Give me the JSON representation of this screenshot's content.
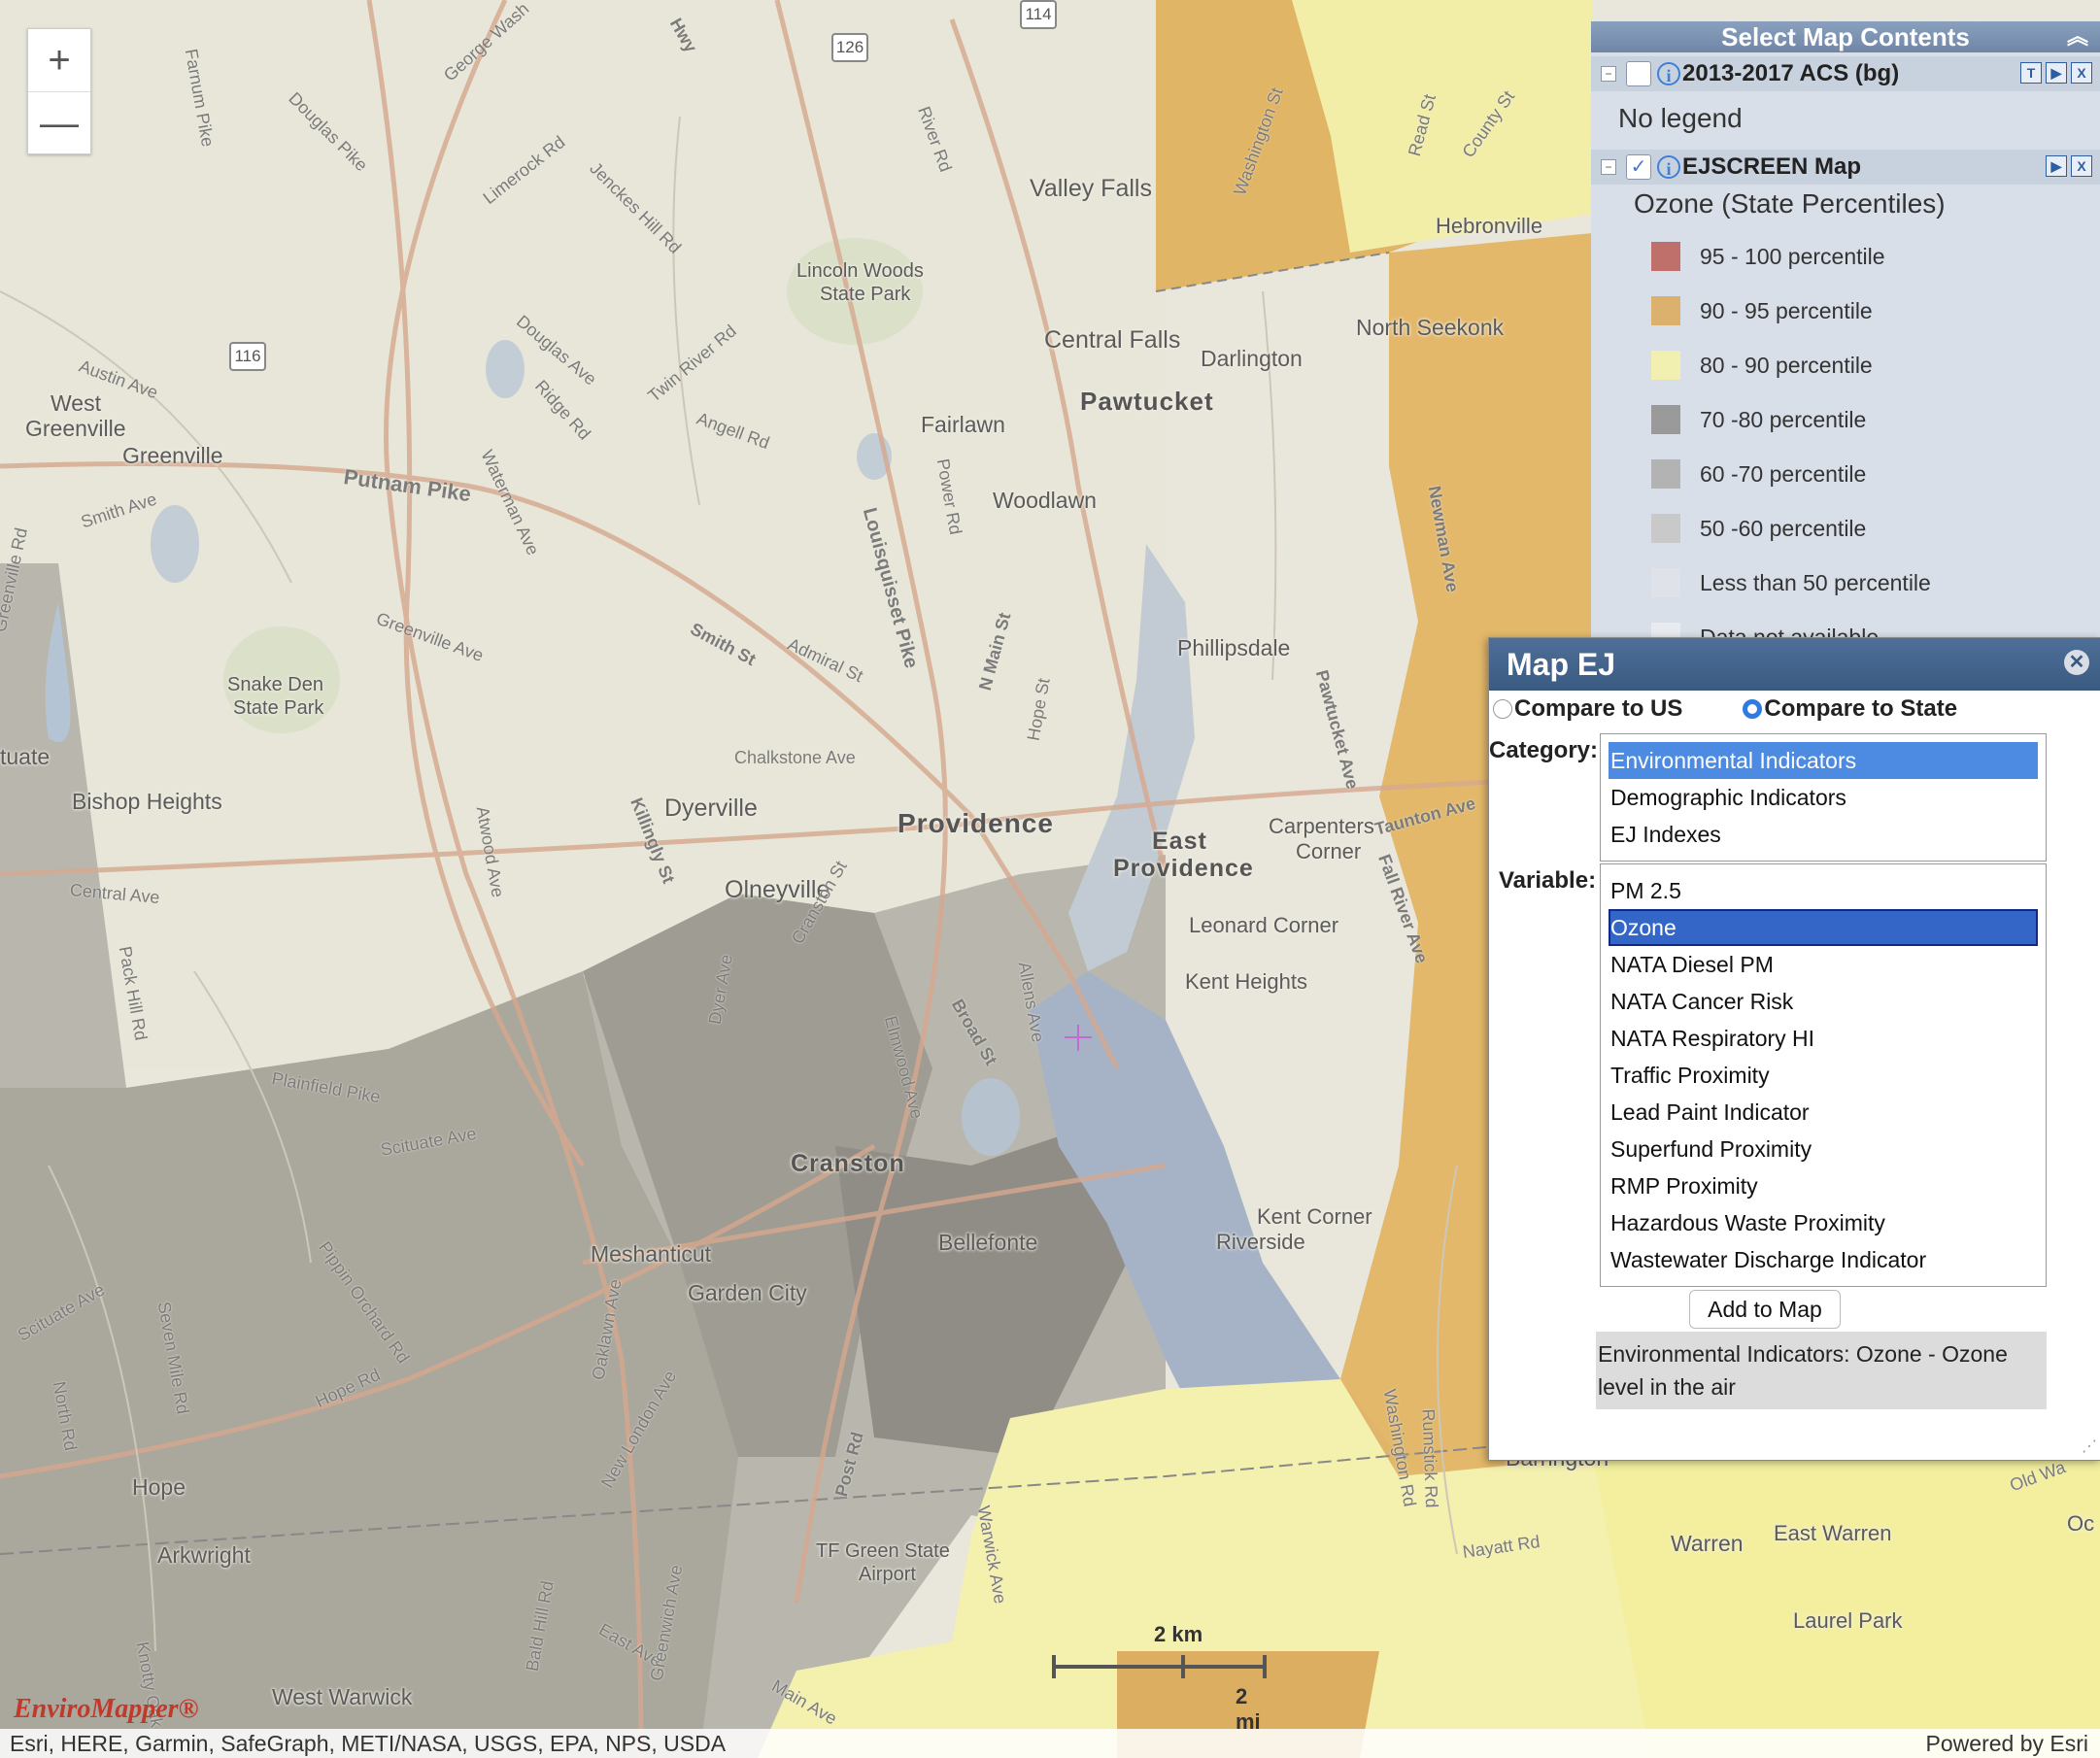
{
  "map": {
    "zoom_in": "+",
    "zoom_out": "—",
    "places": {
      "valley_falls": "Valley Falls",
      "lincoln_woods": "Lincoln Woods",
      "state_park": "State Park",
      "central_falls": "Central Falls",
      "darlington": "Darlington",
      "pawtucket": "Pawtucket",
      "fairlawn": "Fairlawn",
      "woodlawn": "Woodlawn",
      "hebronville": "Hebronville",
      "north_seekonk": "North Seekonk",
      "west_greenville": "West Greenville",
      "west": "West",
      "greenville_a": "Greenville",
      "greenville": "Greenville",
      "phillipsdale": "Phillipsdale",
      "snake_den": "Snake Den",
      "snake_den_sp": "State Park",
      "tuate": "tuate",
      "bishop_heights": "Bishop Heights",
      "dyerville": "Dyerville",
      "providence": "Providence",
      "east": "East",
      "providence2": "Providence",
      "carpenters": "Carpenters",
      "corner": "Corner",
      "olneyville": "Olneyville",
      "leonard_corner": "Leonard Corner",
      "kent_heights": "Kent Heights",
      "cranston": "Cranston",
      "kent_corner": "Kent Corner",
      "riverside": "Riverside",
      "meshanticut": "Meshanticut",
      "bellefonte": "Bellefonte",
      "garden_city": "Garden City",
      "hope": "Hope",
      "arkwright": "Arkwright",
      "warren": "Warren",
      "east_warren": "East Warren",
      "tf_green": "TF Green State",
      "airport": "Airport",
      "laurel_park": "Laurel Park",
      "west_warwick": "West Warwick",
      "barrington": "Barrington",
      "oc": "Oc"
    },
    "roads": {
      "farnum_pike": "Farnum Pike",
      "george_wash": "George Wash",
      "douglas_pike": "Douglas Pike",
      "limerock": "Limerock Rd",
      "jenckes": "Jenckes Hill Rd",
      "river_rd": "River Rd",
      "washington_st": "Washington St",
      "read_st": "Read St",
      "county_st": "County St",
      "twin_river": "Twin River Rd",
      "angell": "Angell Rd",
      "ridge": "Ridge Rd",
      "douglas_ave": "Douglas Ave",
      "austin_ave": "Austin Ave",
      "smith_ave": "Smith Ave",
      "putnam_pike": "Putnam Pike",
      "waterman": "Waterman Ave",
      "louisquisset": "Louisquisset Pike",
      "power_rd": "Power Rd",
      "smith_st": "Smith St",
      "admiral": "Admiral St",
      "n_main": "N Main St",
      "hope_st": "Hope St",
      "greenville_ave": "Greenville Ave",
      "chalkstone": "Chalkstone Ave",
      "atwood": "Atwood Ave",
      "killingly": "Killingly St",
      "newman": "Newman Ave",
      "pawtucket_ave": "Pawtucket Ave",
      "taunton": "Taunton Ave",
      "fall_river": "Fall River Ave",
      "central_ave": "Central Ave",
      "pippin": "Pippin Orchard Rd",
      "cranston_st": "Cranston St",
      "dyer": "Dyer Ave",
      "elmwood": "Elmwood Ave",
      "broad": "Broad St",
      "allens": "Allens Ave",
      "plainfield": "Plainfield Pike",
      "scituate": "Scituate Ave",
      "scituate2": "Scituate Ave",
      "seven_mile": "Seven Mile Rd",
      "hope_rd": "Hope Rd",
      "oaklawn": "Oaklawn Ave",
      "new_london": "New London Ave",
      "post_rd": "Post Rd",
      "warwick": "Warwick Ave",
      "nayatt": "Nayatt Rd",
      "north_rd": "North Rd",
      "pack_hill": "Pack Hill Rd",
      "east_ave": "East Ave",
      "bald_hill": "Bald Hill Rd",
      "greenwich": "Greenwich Ave",
      "main_ave": "Main Ave",
      "greenville_rd": "Greenville Rd",
      "old_wa": "Old Wa",
      "washington_rd": "Washington Rd",
      "rumstick": "Rumstick Rd",
      "knotty": "Knotty Oak",
      "hwy": "Hwy"
    },
    "shields": {
      "s114": "114",
      "s126": "126",
      "s116": "116"
    },
    "scale": {
      "km": "2 km",
      "mi": "2 mi"
    },
    "logo": "EnviroMapper®",
    "attribution": "Esri, HERE, Garmin, SafeGraph, METI/NASA, USGS, EPA, NPS, USDA",
    "powered_by": "Powered by Esri"
  },
  "legend": {
    "title": "Select Map Contents",
    "layer1": {
      "name": "2013-2017 ACS (bg)",
      "legend_text": "No legend",
      "checked": false
    },
    "layer2": {
      "name": "EJSCREEN Map",
      "subtitle": "Ozone (State Percentiles)",
      "checked": true
    },
    "classes": [
      {
        "label": "95 - 100 percentile",
        "color": "#c0706a"
      },
      {
        "label": "90 - 95 percentile",
        "color": "#dcb06d"
      },
      {
        "label": "80 - 90 percentile",
        "color": "#f2f0b0"
      },
      {
        "label": "70 -80 percentile",
        "color": "#9a9a9a"
      },
      {
        "label": "60 -70 percentile",
        "color": "#b3b3b3"
      },
      {
        "label": "50 -60 percentile",
        "color": "#c9c9c9"
      },
      {
        "label": "Less than 50 percentile",
        "color": "#dfe2e8"
      },
      {
        "label": "Data not available",
        "color": "#e8ebf0"
      }
    ]
  },
  "dialog": {
    "title": "Map EJ",
    "compare_us": "Compare to US",
    "compare_state": "Compare to State",
    "selected_compare": "state",
    "category_label": "Category:",
    "categories": [
      "Environmental Indicators",
      "Demographic Indicators",
      "EJ Indexes"
    ],
    "selected_category": "Environmental Indicators",
    "variable_label": "Variable:",
    "variables": [
      "PM 2.5",
      "Ozone",
      "NATA Diesel PM",
      "NATA Cancer Risk",
      "NATA Respiratory HI",
      "Traffic Proximity",
      "Lead Paint Indicator",
      "Superfund Proximity",
      "RMP Proximity",
      "Hazardous Waste Proximity",
      "Wastewater Discharge Indicator"
    ],
    "selected_variable": "Ozone",
    "add_button": "Add to Map",
    "description": "Environmental Indicators: Ozone - Ozone level in the air"
  }
}
